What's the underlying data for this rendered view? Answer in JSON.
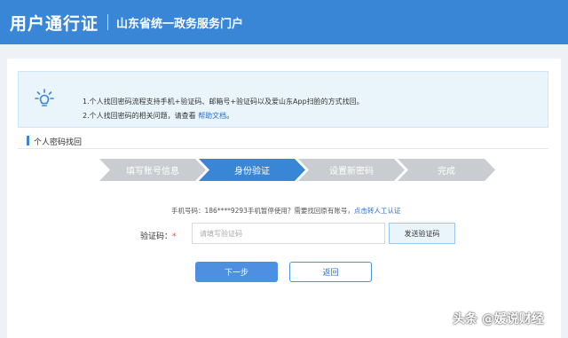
{
  "header": {
    "brand": "用户通行证",
    "portal": "山东省统一政务服务门户"
  },
  "notice": {
    "icon": "lightbulb-icon",
    "line1": "1.个人找回密码流程支持手机+验证码、邮箱号+验证码以及爱山东App扫脸的方式找回。",
    "line2_prefix": "2.个人找回密码的相关问题，请查看",
    "help_link": "帮助文档",
    "line2_suffix": "。"
  },
  "section": {
    "title": "个人密码找回"
  },
  "steps": [
    {
      "label": "填写账号信息",
      "state": "done"
    },
    {
      "label": "身份验证",
      "state": "active"
    },
    {
      "label": "设置新密码",
      "state": "pending"
    },
    {
      "label": "完成",
      "state": "pending"
    }
  ],
  "phone_info": {
    "text": "手机号码：186****9293手机暂停使用？需要找回原有账号，",
    "link": "点击转人工认证"
  },
  "form": {
    "code_label": "验证码：",
    "required_mark": "*",
    "code_placeholder": "请填写验证码",
    "code_value": "",
    "send_button": "发送验证码"
  },
  "buttons": {
    "next": "下一步",
    "back": "返回"
  },
  "watermark": "头条 @媛说财经",
  "colors": {
    "header": "#3a86d6",
    "active_step": "#3a86d6",
    "inactive_step": "#c9ccd0",
    "link": "#2a6fc9",
    "primary_button": "#4d8fe0"
  }
}
